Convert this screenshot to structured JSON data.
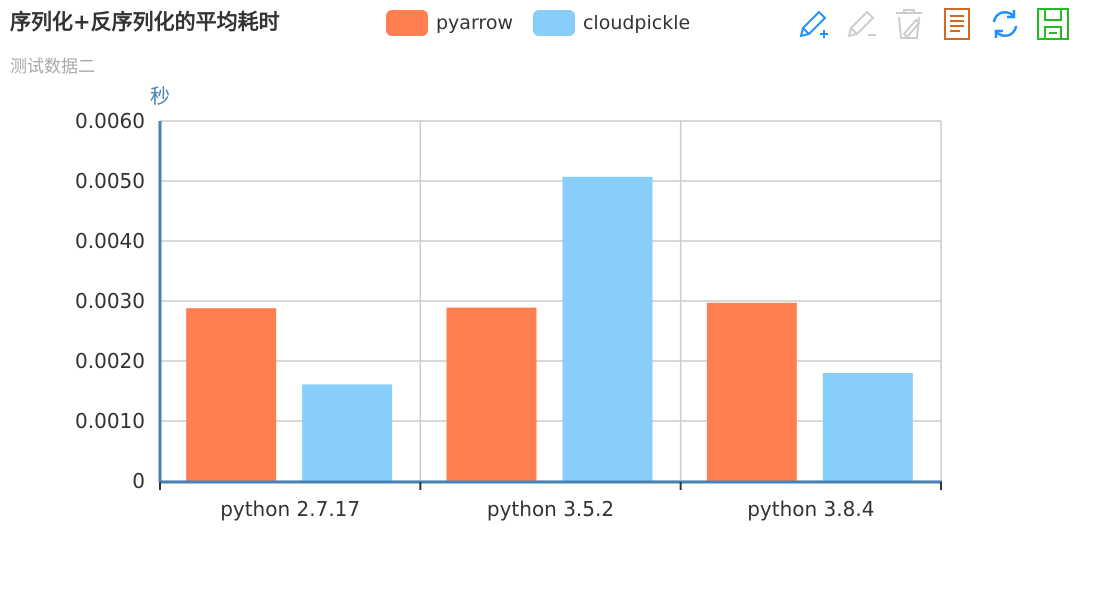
{
  "chart_data": {
    "type": "bar",
    "title": "序列化+反序列化的平均耗时",
    "subtitle": "测试数据二",
    "ylabel": "秒",
    "categories": [
      "python 2.7.17",
      "python 3.5.2",
      "python 3.8.4"
    ],
    "series": [
      {
        "name": "pyarrow",
        "color": "#ff7f50",
        "values": [
          0.00288,
          0.00289,
          0.00297
        ]
      },
      {
        "name": "cloudpickle",
        "color": "#87cefa",
        "values": [
          0.00161,
          0.00507,
          0.0018
        ]
      }
    ],
    "ylim": [
      0,
      0.006
    ],
    "yticks": [
      "0",
      "0.0010",
      "0.0020",
      "0.0030",
      "0.0040",
      "0.0050",
      "0.0060"
    ],
    "grid": true,
    "legend_position": "top"
  },
  "toolbox": [
    {
      "icon": "zoom-in-icon",
      "color": "#1e90ff"
    },
    {
      "icon": "zoom-out-icon",
      "color": "#cccccc"
    },
    {
      "icon": "restore-delete-icon",
      "color": "#cccccc"
    },
    {
      "icon": "data-view-icon",
      "color": "#d2691e"
    },
    {
      "icon": "refresh-icon",
      "color": "#1e90ff"
    },
    {
      "icon": "save-image-icon",
      "color": "#22bb22"
    }
  ]
}
